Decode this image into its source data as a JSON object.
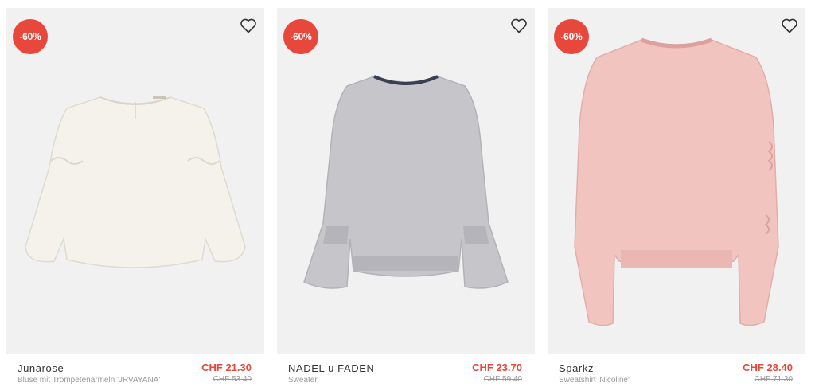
{
  "colors": {
    "discount_badge": "#e8473b",
    "sale_price": "#e8473b",
    "card_background": "#f1f1f1",
    "muted_text": "#999999"
  },
  "products": [
    {
      "discount": "-60%",
      "brand": "Junarose",
      "name": "Bluse mit Trompetenärmeln 'JRVAYANA'",
      "price": "CHF 21.30",
      "old_price": "CHF 53.40",
      "wishlist_icon": "heart-outline-icon"
    },
    {
      "discount": "-60%",
      "brand": "NADEL u FADEN",
      "name": "Sweater",
      "price": "CHF 23.70",
      "old_price": "CHF 59.40",
      "wishlist_icon": "heart-outline-icon"
    },
    {
      "discount": "-60%",
      "brand": "Sparkz",
      "name": "Sweatshirt 'Nicoline'",
      "price": "CHF 28.40",
      "old_price": "CHF 71.30",
      "wishlist_icon": "heart-outline-icon"
    }
  ]
}
